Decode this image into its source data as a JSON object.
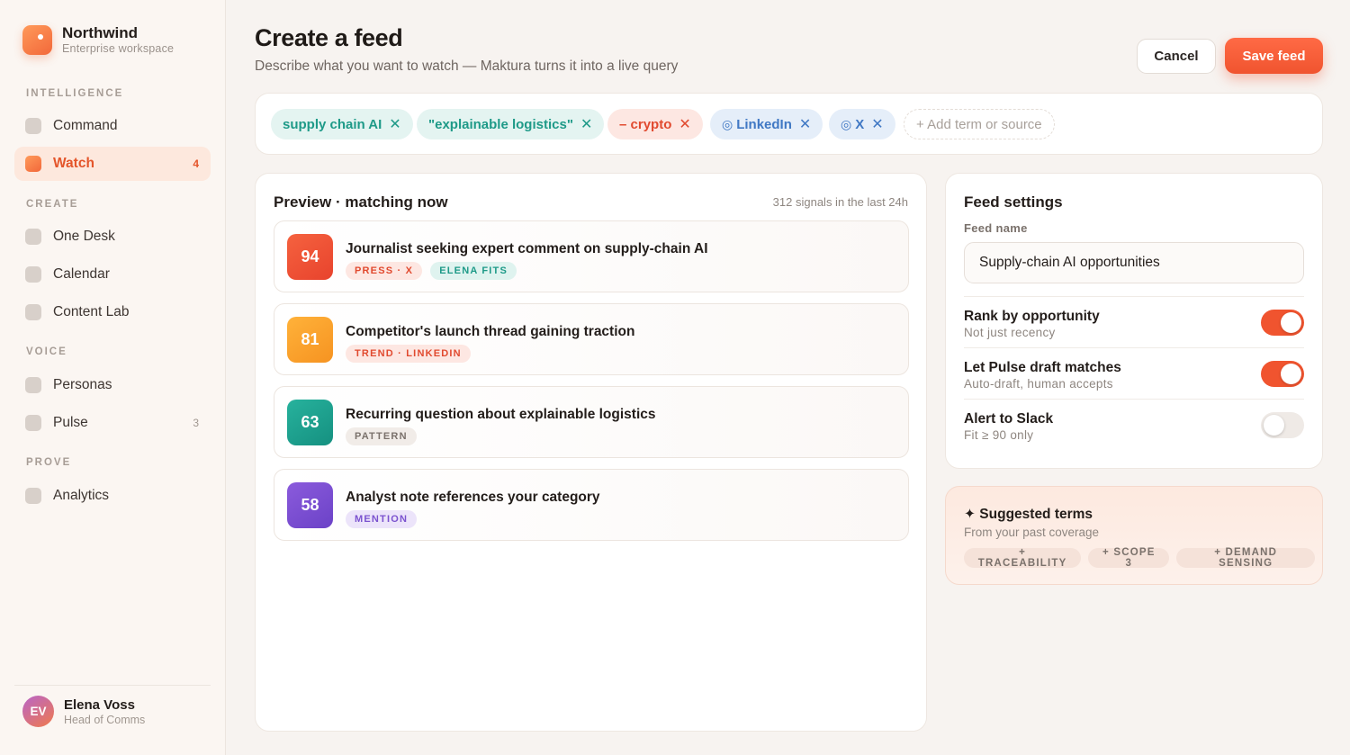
{
  "brand": {
    "name": "Northwind",
    "subtitle": "Enterprise workspace"
  },
  "sidebar": {
    "sections": [
      {
        "label": "INTELLIGENCE"
      },
      {
        "label": "CREATE"
      },
      {
        "label": "VOICE"
      },
      {
        "label": "PROVE"
      }
    ],
    "items": [
      {
        "label": "Command",
        "count": ""
      },
      {
        "label": "Watch",
        "count": "4",
        "active": true
      },
      {
        "label": "One Desk",
        "count": ""
      },
      {
        "label": "Calendar",
        "count": ""
      },
      {
        "label": "Content Lab",
        "count": ""
      },
      {
        "label": "Personas",
        "count": ""
      },
      {
        "label": "Pulse",
        "count": "3"
      },
      {
        "label": "Analytics",
        "count": ""
      }
    ]
  },
  "user": {
    "initials": "EV",
    "name": "Elena Voss",
    "role": "Head of Comms"
  },
  "header": {
    "title": "Create a feed",
    "subtitle": "Describe what you want to watch — Maktura turns it into a live query",
    "cancel_label": "Cancel",
    "save_label": "Save feed"
  },
  "query": {
    "chips": [
      {
        "text": "supply chain AI",
        "kind": "include"
      },
      {
        "text": "\"explainable logistics\"",
        "kind": "include"
      },
      {
        "text": "– crypto",
        "kind": "exclude"
      },
      {
        "text": "LinkedIn",
        "kind": "source"
      },
      {
        "text": "X",
        "kind": "source"
      }
    ],
    "remove_glyph": "✕",
    "source_glyph": "◎",
    "add_label": "+ Add term or source"
  },
  "preview": {
    "title": "Preview · matching now",
    "meta": "312 signals in the last 24h",
    "signals": [
      {
        "score": "94",
        "title": "Journalist seeking expert comment on supply-chain AI",
        "tags": [
          "PRESS · X",
          "ELENA FITS"
        ]
      },
      {
        "score": "81",
        "title": "Competitor's launch thread gaining traction",
        "tags": [
          "TREND · LINKEDIN"
        ]
      },
      {
        "score": "63",
        "title": "Recurring question about explainable logistics",
        "tags": [
          "PATTERN"
        ]
      },
      {
        "score": "58",
        "title": "Analyst note references your category",
        "tags": [
          "MENTION"
        ]
      }
    ]
  },
  "settings": {
    "title": "Feed settings",
    "feed_name_label": "Feed name",
    "feed_name_value": "Supply-chain AI opportunities",
    "rows": [
      {
        "name": "Rank by opportunity",
        "desc": "Not just recency",
        "enabled": true
      },
      {
        "name": "Let Pulse draft matches",
        "desc": "Auto-draft, human accepts",
        "enabled": true
      },
      {
        "name": "Alert to Slack",
        "desc": "Fit ≥ 90 only",
        "enabled": false
      }
    ]
  },
  "suggested": {
    "title": "✦ Suggested terms",
    "subtitle": "From your past coverage",
    "terms": [
      "+ TRACEABILITY",
      "+ SCOPE 3",
      "+ DEMAND SENSING"
    ]
  },
  "colors": {
    "accent": "#f0542f",
    "active_nav_bg": "#fde8dd",
    "score_high": "#e8432d",
    "score_mid": "#f69321",
    "score_teal": "#159080",
    "score_purple": "#6b42c7",
    "include_chip": "#1e9a88",
    "exclude_chip": "#e14a2f",
    "source_chip": "#4078c4"
  }
}
